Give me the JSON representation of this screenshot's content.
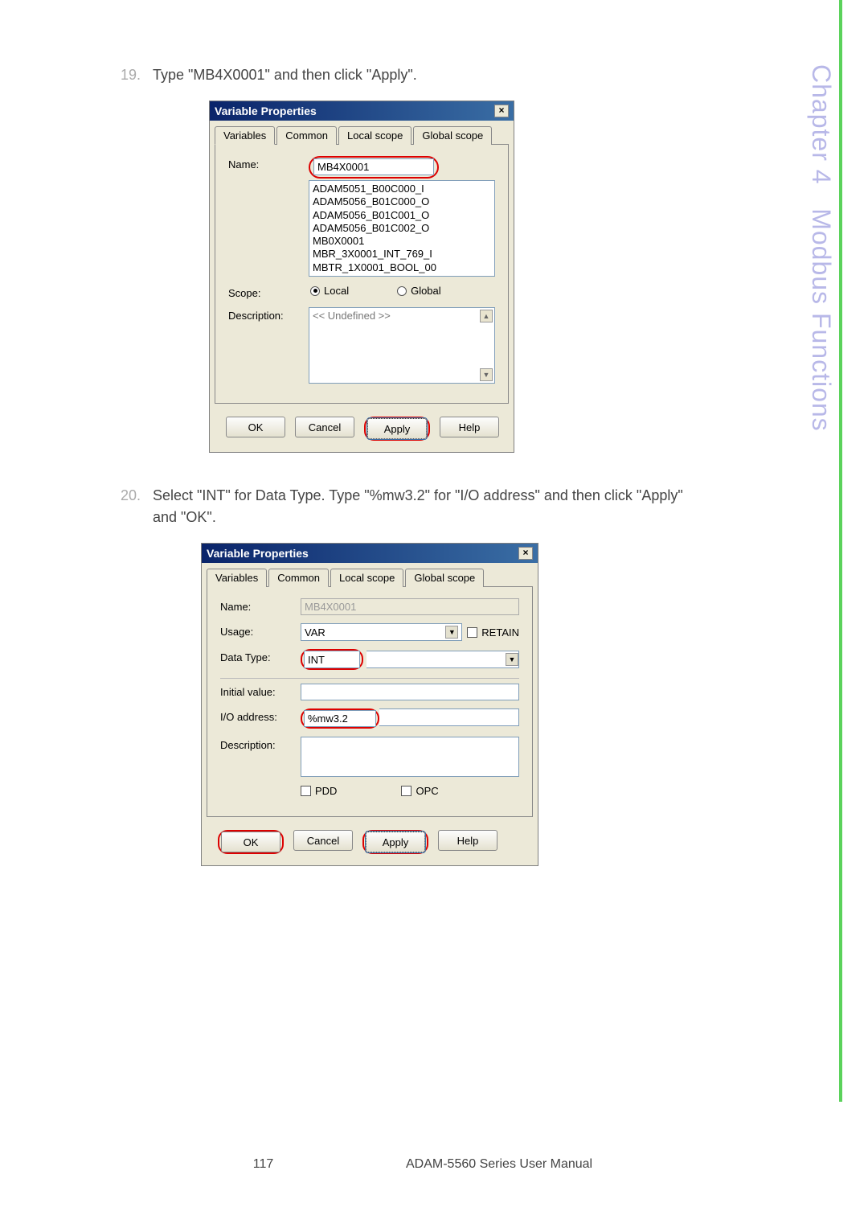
{
  "side": {
    "chapter_label": "Chapter 4",
    "chapter_title": "Modbus Functions"
  },
  "step1": {
    "num": "19.",
    "text": "Type \"MB4X0001\" and then click \"Apply\"."
  },
  "dialog1": {
    "title": "Variable Properties",
    "tabs": [
      "Variables",
      "Common",
      "Local scope",
      "Global scope"
    ],
    "active_tab": 0,
    "name_label": "Name:",
    "name_value": "MB4X0001",
    "list_items": [
      "ADAM5051_B00C000_I",
      "ADAM5056_B01C000_O",
      "ADAM5056_B01C001_O",
      "ADAM5056_B01C002_O",
      "MB0X0001",
      "MBR_3X0001_INT_769_I",
      "MBTR_1X0001_BOOL_00"
    ],
    "scope_label": "Scope:",
    "scope_local": "Local",
    "scope_global": "Global",
    "desc_label": "Description:",
    "desc_value": "<< Undefined >>",
    "buttons": {
      "ok": "OK",
      "cancel": "Cancel",
      "apply": "Apply",
      "help": "Help"
    }
  },
  "step2": {
    "num": "20.",
    "text": "Select \"INT\" for Data Type. Type \"%mw3.2\" for \"I/O address\" and then click \"Apply\" and \"OK\"."
  },
  "dialog2": {
    "title": "Variable Properties",
    "tabs": [
      "Variables",
      "Common",
      "Local scope",
      "Global scope"
    ],
    "active_tab": 1,
    "name_label": "Name:",
    "name_value": "MB4X0001",
    "usage_label": "Usage:",
    "usage_value": "VAR",
    "retain": "RETAIN",
    "dtype_label": "Data Type:",
    "dtype_value": "INT",
    "init_label": "Initial value:",
    "init_value": "",
    "io_label": "I/O address:",
    "io_value": "%mw3.2",
    "desc_label": "Description:",
    "pdd": "PDD",
    "opc": "OPC",
    "buttons": {
      "ok": "OK",
      "cancel": "Cancel",
      "apply": "Apply",
      "help": "Help"
    }
  },
  "footer": {
    "page": "117",
    "manual": "ADAM-5560 Series User Manual"
  }
}
